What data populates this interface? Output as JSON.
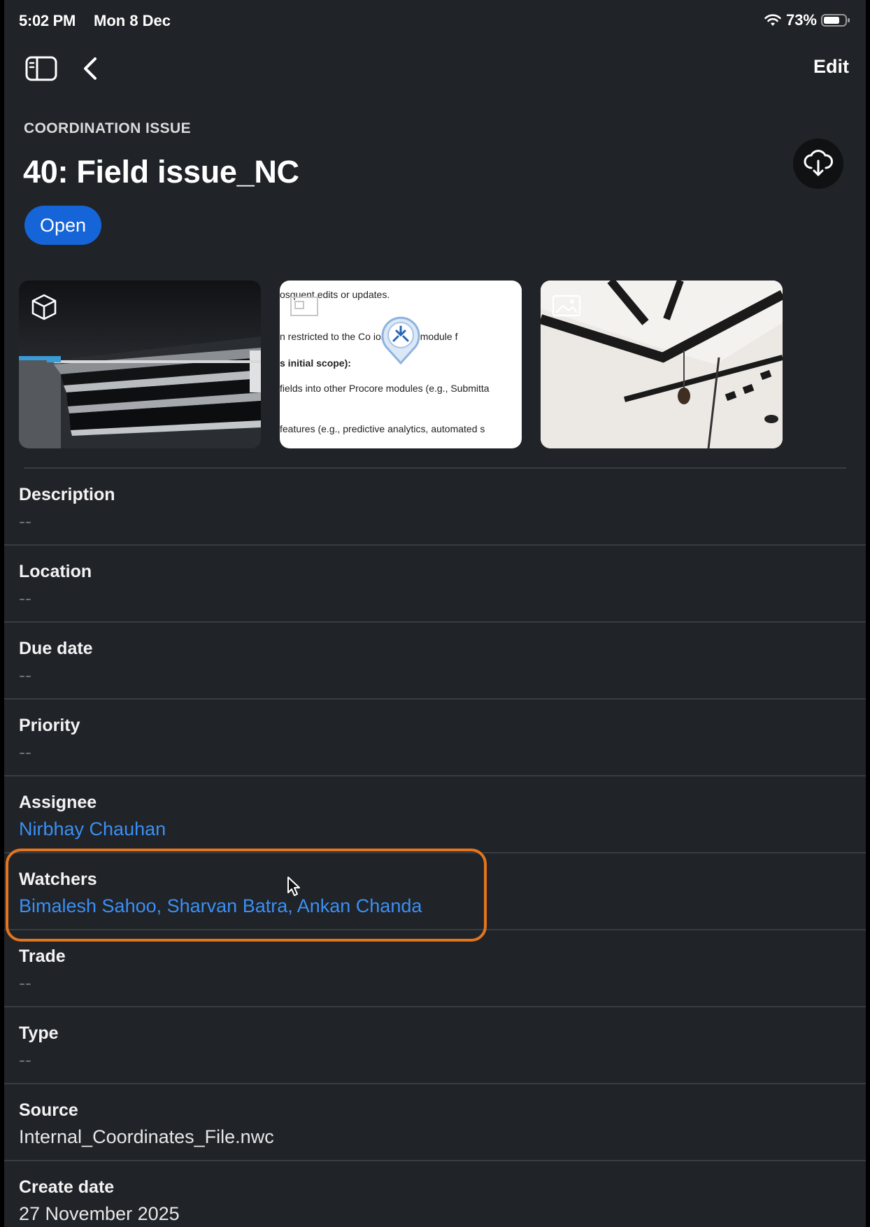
{
  "status_bar": {
    "time": "5:02 PM",
    "date": "Mon 8 Dec",
    "battery": "73%"
  },
  "nav": {
    "edit_label": "Edit"
  },
  "header": {
    "kicker": "COORDINATION ISSUE",
    "title": "40: Field issue_NC",
    "status": "Open"
  },
  "attachment_doc_lines": [
    "osquent edits or updates.",
    "n restricted to the Co              ion Issues module f",
    "s initial scope):",
    "fields into other Procore modules (e.g., Submitta",
    "features (e.g., predictive analytics, automated s"
  ],
  "fields": [
    {
      "label": "Description",
      "value": "--"
    },
    {
      "label": "Location",
      "value": "--"
    },
    {
      "label": "Due date",
      "value": "--"
    },
    {
      "label": "Priority",
      "value": "--"
    },
    {
      "label": "Assignee",
      "value": "Nirbhay Chauhan"
    },
    {
      "label": "Watchers",
      "value": "Bimalesh Sahoo, Sharvan Batra, Ankan Chanda"
    },
    {
      "label": "Trade",
      "value": "--"
    },
    {
      "label": "Type",
      "value": "--"
    },
    {
      "label": "Source",
      "value": "Internal_Coordinates_File.nwc"
    },
    {
      "label": "Create date",
      "value": "27 November 2025"
    }
  ],
  "colors": {
    "accent": "#1565d8",
    "link": "#3a8ff5",
    "highlight": "#e4751f",
    "background": "#202327"
  }
}
